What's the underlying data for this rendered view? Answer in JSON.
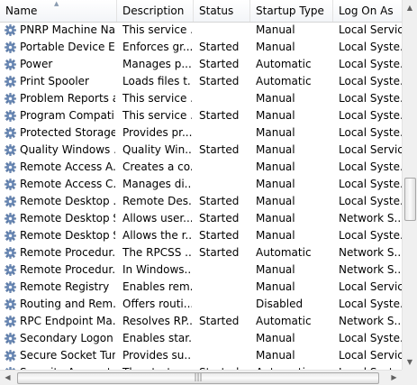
{
  "columns": [
    "Name",
    "Description",
    "Status",
    "Startup Type",
    "Log On As"
  ],
  "rows": [
    [
      "PNRP Machine Na...",
      "This service ...",
      "",
      "Manual",
      "Local Service"
    ],
    [
      "Portable Device E...",
      "Enforces gr...",
      "Started",
      "Manual",
      "Local Syste..."
    ],
    [
      "Power",
      "Manages p...",
      "Started",
      "Automatic",
      "Local Syste..."
    ],
    [
      "Print Spooler",
      "Loads files t...",
      "Started",
      "Automatic",
      "Local Syste..."
    ],
    [
      "Problem Reports a...",
      "This service ...",
      "",
      "Manual",
      "Local Syste..."
    ],
    [
      "Program Compati...",
      "This service ...",
      "Started",
      "Manual",
      "Local Syste..."
    ],
    [
      "Protected Storage",
      "Provides pr...",
      "",
      "Manual",
      "Local Syste..."
    ],
    [
      "Quality Windows ...",
      "Quality Win...",
      "Started",
      "Manual",
      "Local Service"
    ],
    [
      "Remote Access A...",
      "Creates a co...",
      "",
      "Manual",
      "Local Syste..."
    ],
    [
      "Remote Access C...",
      "Manages di...",
      "",
      "Manual",
      "Local Syste..."
    ],
    [
      "Remote Desktop ...",
      "Remote Des...",
      "Started",
      "Manual",
      "Local Syste..."
    ],
    [
      "Remote Desktop S...",
      "Allows user...",
      "Started",
      "Manual",
      "Network S..."
    ],
    [
      "Remote Desktop S...",
      "Allows the r...",
      "Started",
      "Manual",
      "Local Syste..."
    ],
    [
      "Remote Procedur...",
      "The RPCSS ...",
      "Started",
      "Automatic",
      "Network S..."
    ],
    [
      "Remote Procedur...",
      "In Windows...",
      "",
      "Manual",
      "Network S..."
    ],
    [
      "Remote Registry",
      "Enables rem...",
      "",
      "Manual",
      "Local Service"
    ],
    [
      "Routing and Rem...",
      "Offers routi...",
      "",
      "Disabled",
      "Local Syste..."
    ],
    [
      "RPC Endpoint Ma...",
      "Resolves RP...",
      "Started",
      "Automatic",
      "Network S..."
    ],
    [
      "Secondary Logon",
      "Enables star...",
      "",
      "Manual",
      "Local Syste..."
    ],
    [
      "Secure Socket Tun...",
      "Provides su...",
      "",
      "Manual",
      "Local Service"
    ],
    [
      "Security Accounts...",
      "The startup ...",
      "Started",
      "Automatic",
      "Local Syste..."
    ]
  ],
  "icon": "service-gear-icon",
  "colors": {
    "header_bg": "#f3f5f8",
    "grid_line": "#e3e3e3",
    "scroll_bg": "#f0f0f0"
  }
}
